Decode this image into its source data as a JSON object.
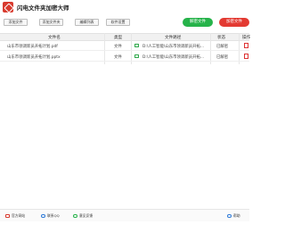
{
  "app": {
    "title": "闪电文件夹加密大师"
  },
  "toolbar": {
    "buttons": [
      "添加文件",
      "添加文件夹",
      "编辑列表",
      "软件设置"
    ],
    "decrypt_label": "解密文件",
    "encrypt_label": "加密文件"
  },
  "table": {
    "headers": {
      "name": "文件名",
      "type": "类型",
      "path": "文件路径",
      "status": "状态",
      "op": "操作"
    },
    "rows": [
      {
        "name": "山东市领调新员开拓计划.pdf",
        "type": "文件",
        "path": "D:\\人工智能\\山东市领调新员开拓...",
        "status": "已解密"
      },
      {
        "name": "山东市领调新员开拓计划.pptx",
        "type": "文件",
        "path": "D:\\人工智能\\山东市领调新员开拓...",
        "status": "已解密"
      }
    ]
  },
  "bottombar": {
    "official_site": "官方网站",
    "qq_contact": "联系QQ",
    "feedback": "意见反馈",
    "help": "帮助"
  },
  "colors": {
    "green": "#26b34a",
    "red": "#e33a32",
    "logo": "#d83a2e"
  }
}
